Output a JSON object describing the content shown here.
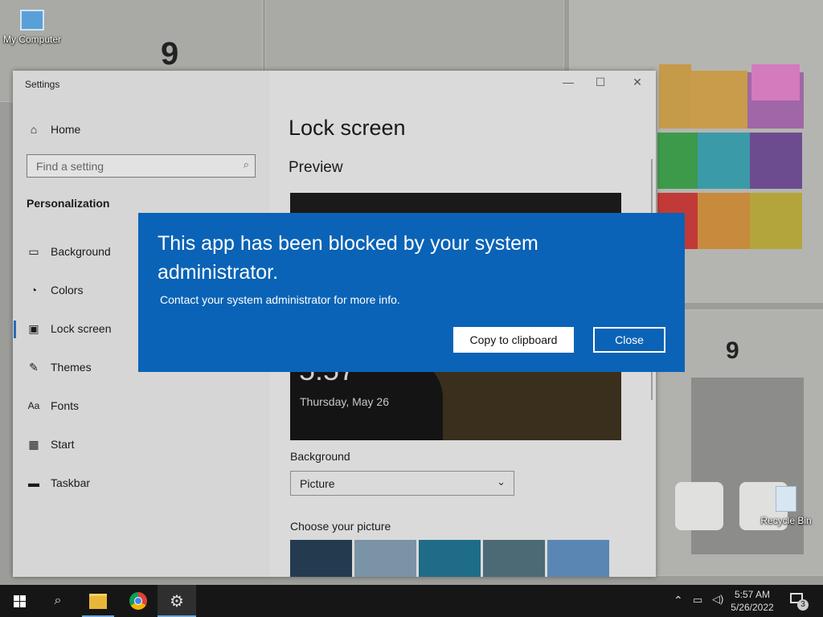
{
  "desktop": {
    "icons": [
      "My Computer",
      "Recycle Bin"
    ]
  },
  "settings_window": {
    "title": "Settings",
    "window_controls": [
      "—",
      "☐",
      "✕"
    ],
    "nav": {
      "home_label": "Home",
      "search_placeholder": "Find a setting",
      "section_header": "Personalization",
      "items": [
        {
          "label": "Background",
          "icon": "picture-icon"
        },
        {
          "label": "Colors",
          "icon": "palette-icon"
        },
        {
          "label": "Lock screen",
          "icon": "lock-screen-icon",
          "selected": true
        },
        {
          "label": "Themes",
          "icon": "brush-icon"
        },
        {
          "label": "Fonts",
          "icon": "fonts-icon"
        },
        {
          "label": "Start",
          "icon": "start-icon"
        },
        {
          "label": "Taskbar",
          "icon": "taskbar-icon"
        }
      ]
    },
    "content": {
      "page_title": "Lock screen",
      "preview_header": "Preview",
      "preview_time": "5:57",
      "preview_date": "Thursday, May 26",
      "background_label": "Background",
      "background_value": "Picture",
      "choose_picture_label": "Choose your picture"
    }
  },
  "dialog": {
    "title": "This app has been blocked by your system administrator.",
    "message": "Contact your system administrator for more info.",
    "copy_button": "Copy to clipboard",
    "close_button": "Close",
    "color": "#0a63b6"
  },
  "taskbar": {
    "time": "5:57 AM",
    "date": "5/26/2022",
    "notification_count": "3"
  }
}
